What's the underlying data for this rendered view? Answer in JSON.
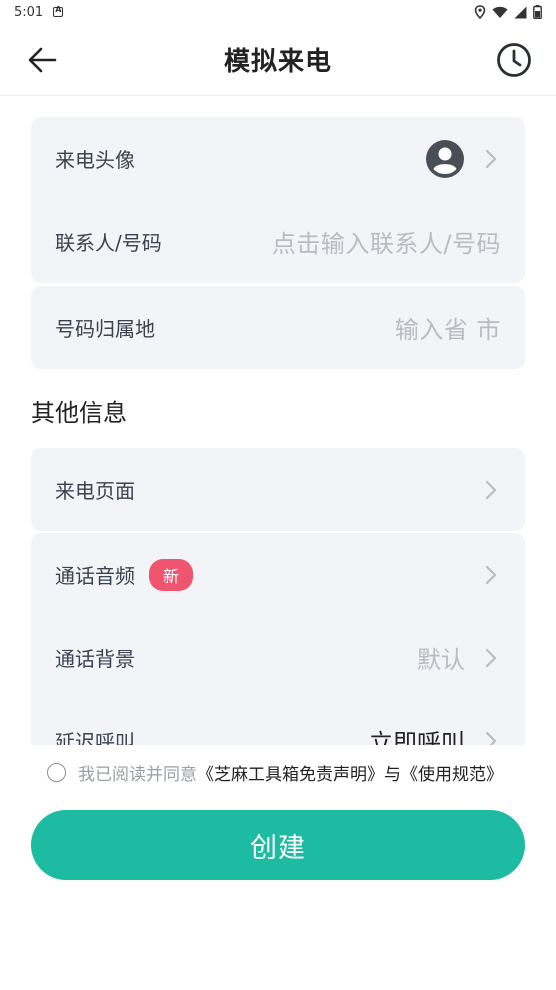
{
  "status_bar": {
    "time": "5:01"
  },
  "app_bar": {
    "title": "模拟来电"
  },
  "card_caller": {
    "avatar_label": "来电头像",
    "contact_label": "联系人/号码",
    "contact_placeholder": "点击输入联系人/号码"
  },
  "card_location": {
    "label": "号码归属地",
    "placeholder": "输入省 市"
  },
  "other_section": {
    "title": "其他信息"
  },
  "card_page": {
    "label": "来电页面"
  },
  "card_settings": {
    "audio_label": "通话音频",
    "audio_badge": "新",
    "background_label": "通话背景",
    "background_value": "默认",
    "delay_label": "延迟呼叫",
    "delay_value": "立即呼叫"
  },
  "agreement": {
    "prefix": "我已阅读并同意",
    "disclaimer_link": "《芝麻工具箱免责声明》",
    "joiner": "与",
    "usage_link": "《使用规范》"
  },
  "create_button": {
    "label": "创建"
  },
  "colors": {
    "accent": "#1cbba2",
    "badge": "#f05570",
    "card_bg": "#f3f4f7"
  }
}
